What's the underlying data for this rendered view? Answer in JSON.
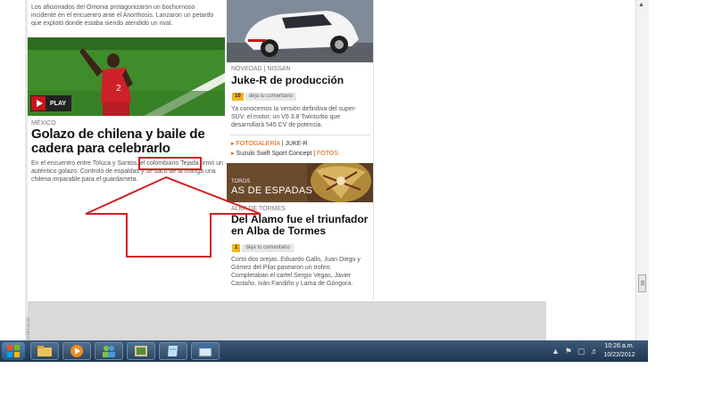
{
  "left_article": {
    "top_snippet": "Los aficionados del Omonia protagonizaron un bochornoso incidente en el encuentro ante el Anorthosis. Lanzaron un petardo que explotó donde estaba siendo atendido un rival.",
    "play_label": "PLAY",
    "kicker": "MÉXICO",
    "headline": "Golazo de chilena y baile de cadera para celebrarlo",
    "body": "En el encuentro entre Toluca y Santos, el colombiano Tejada firmó un auténtico golazo. Controló de espaldas y se sacó de la manga una chilena imparable para el guardameta."
  },
  "right_article1": {
    "kicker": "NOVEDAD | NISSAN",
    "headline": "Juke-R de producción",
    "comment_count": "10",
    "comment_label": "deja tu comentario",
    "body": "Ya conocemos la versión definitiva del super-SUV. el motor, un V6 3.8 Twinturbo que desarrollará 545 CV de potencia.",
    "links": {
      "row1_accent": "FOTOGALERÍA",
      "row1_rest": " | JUKE-R",
      "row2_text": "Suzuki Swift Sport Concept",
      "row2_sep": " | ",
      "row2_accent": "FOTOS"
    }
  },
  "banner": {
    "small": "TOROS",
    "big": "AS DE ESPADAS"
  },
  "right_article2": {
    "kicker": "ALBA DE TORMES",
    "headline": "Del Álamo fue el triunfador en Alba de Tormes",
    "comment_count": "1",
    "comment_label": "deja tu comentario",
    "body": "Cortó dos orejas. Eduardo Gallo, Juan Diego y Gómez del Pilar pasearon un trofeo. Completaban el cartel Sergio Vegas, Javier Castaño, Iván Fandiño y Lama de Góngora."
  },
  "ad_label": "publicidad",
  "taskbar": {
    "time": "10:26 a.m.",
    "date": "10/22/2012",
    "apps": [
      "explorer-folder-icon",
      "media-player-icon",
      "network-people-icon",
      "photo-gallery-icon",
      "notes-icon",
      "window-icon"
    ]
  },
  "annotation": {
    "box_color": "#d42020",
    "arrow_color": "#d42020"
  }
}
